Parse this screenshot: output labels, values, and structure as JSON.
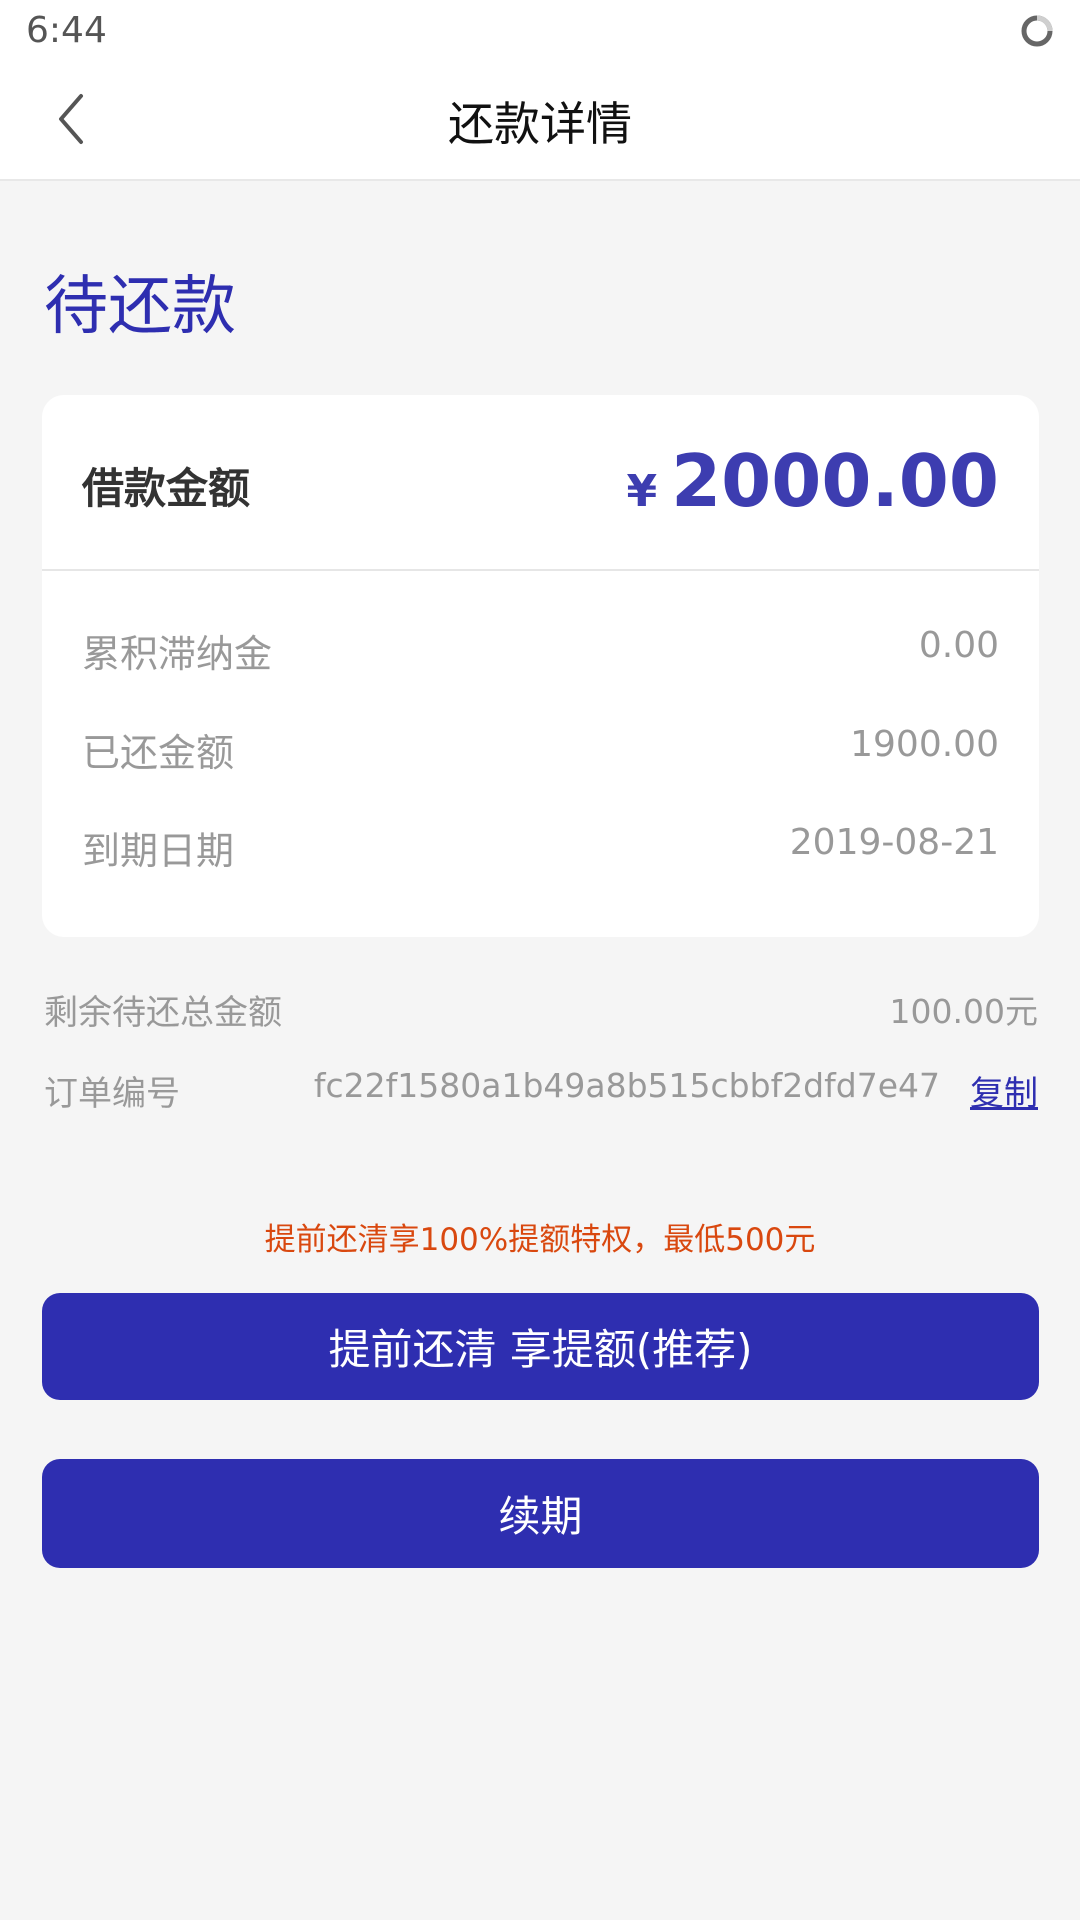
{
  "status_bar": {
    "time": "6:44",
    "icons": [
      "loading-ring-icon"
    ]
  },
  "nav": {
    "title": "还款详情",
    "back_icon": "chevron-left-icon"
  },
  "section": {
    "heading": "待还款"
  },
  "card": {
    "loan_label": "借款金额",
    "currency": "¥",
    "loan_amount": "2000.00",
    "rows": [
      {
        "label": "累积滞纳金",
        "value": "0.00"
      },
      {
        "label": "已还金额",
        "value": "1900.00"
      },
      {
        "label": "到期日期",
        "value": "2019-08-21"
      }
    ]
  },
  "summary": {
    "remaining_label": "剩余待还总金额",
    "remaining_value": "100.00元",
    "order_label": "订单编号",
    "order_value": "fc22f1580a1b49a8b515cbbf2dfd7e47",
    "copy_label": "复制"
  },
  "promo": {
    "text": "提前还清享100%提额特权，最低500元"
  },
  "buttons": {
    "repay_early_label": "提前还清 享提额(推荐)",
    "renew_label": "续期"
  },
  "colors": {
    "accent": "#2e2eb0",
    "promo": "#d9480f",
    "background": "#f5f5f5",
    "muted_text": "#999999"
  }
}
